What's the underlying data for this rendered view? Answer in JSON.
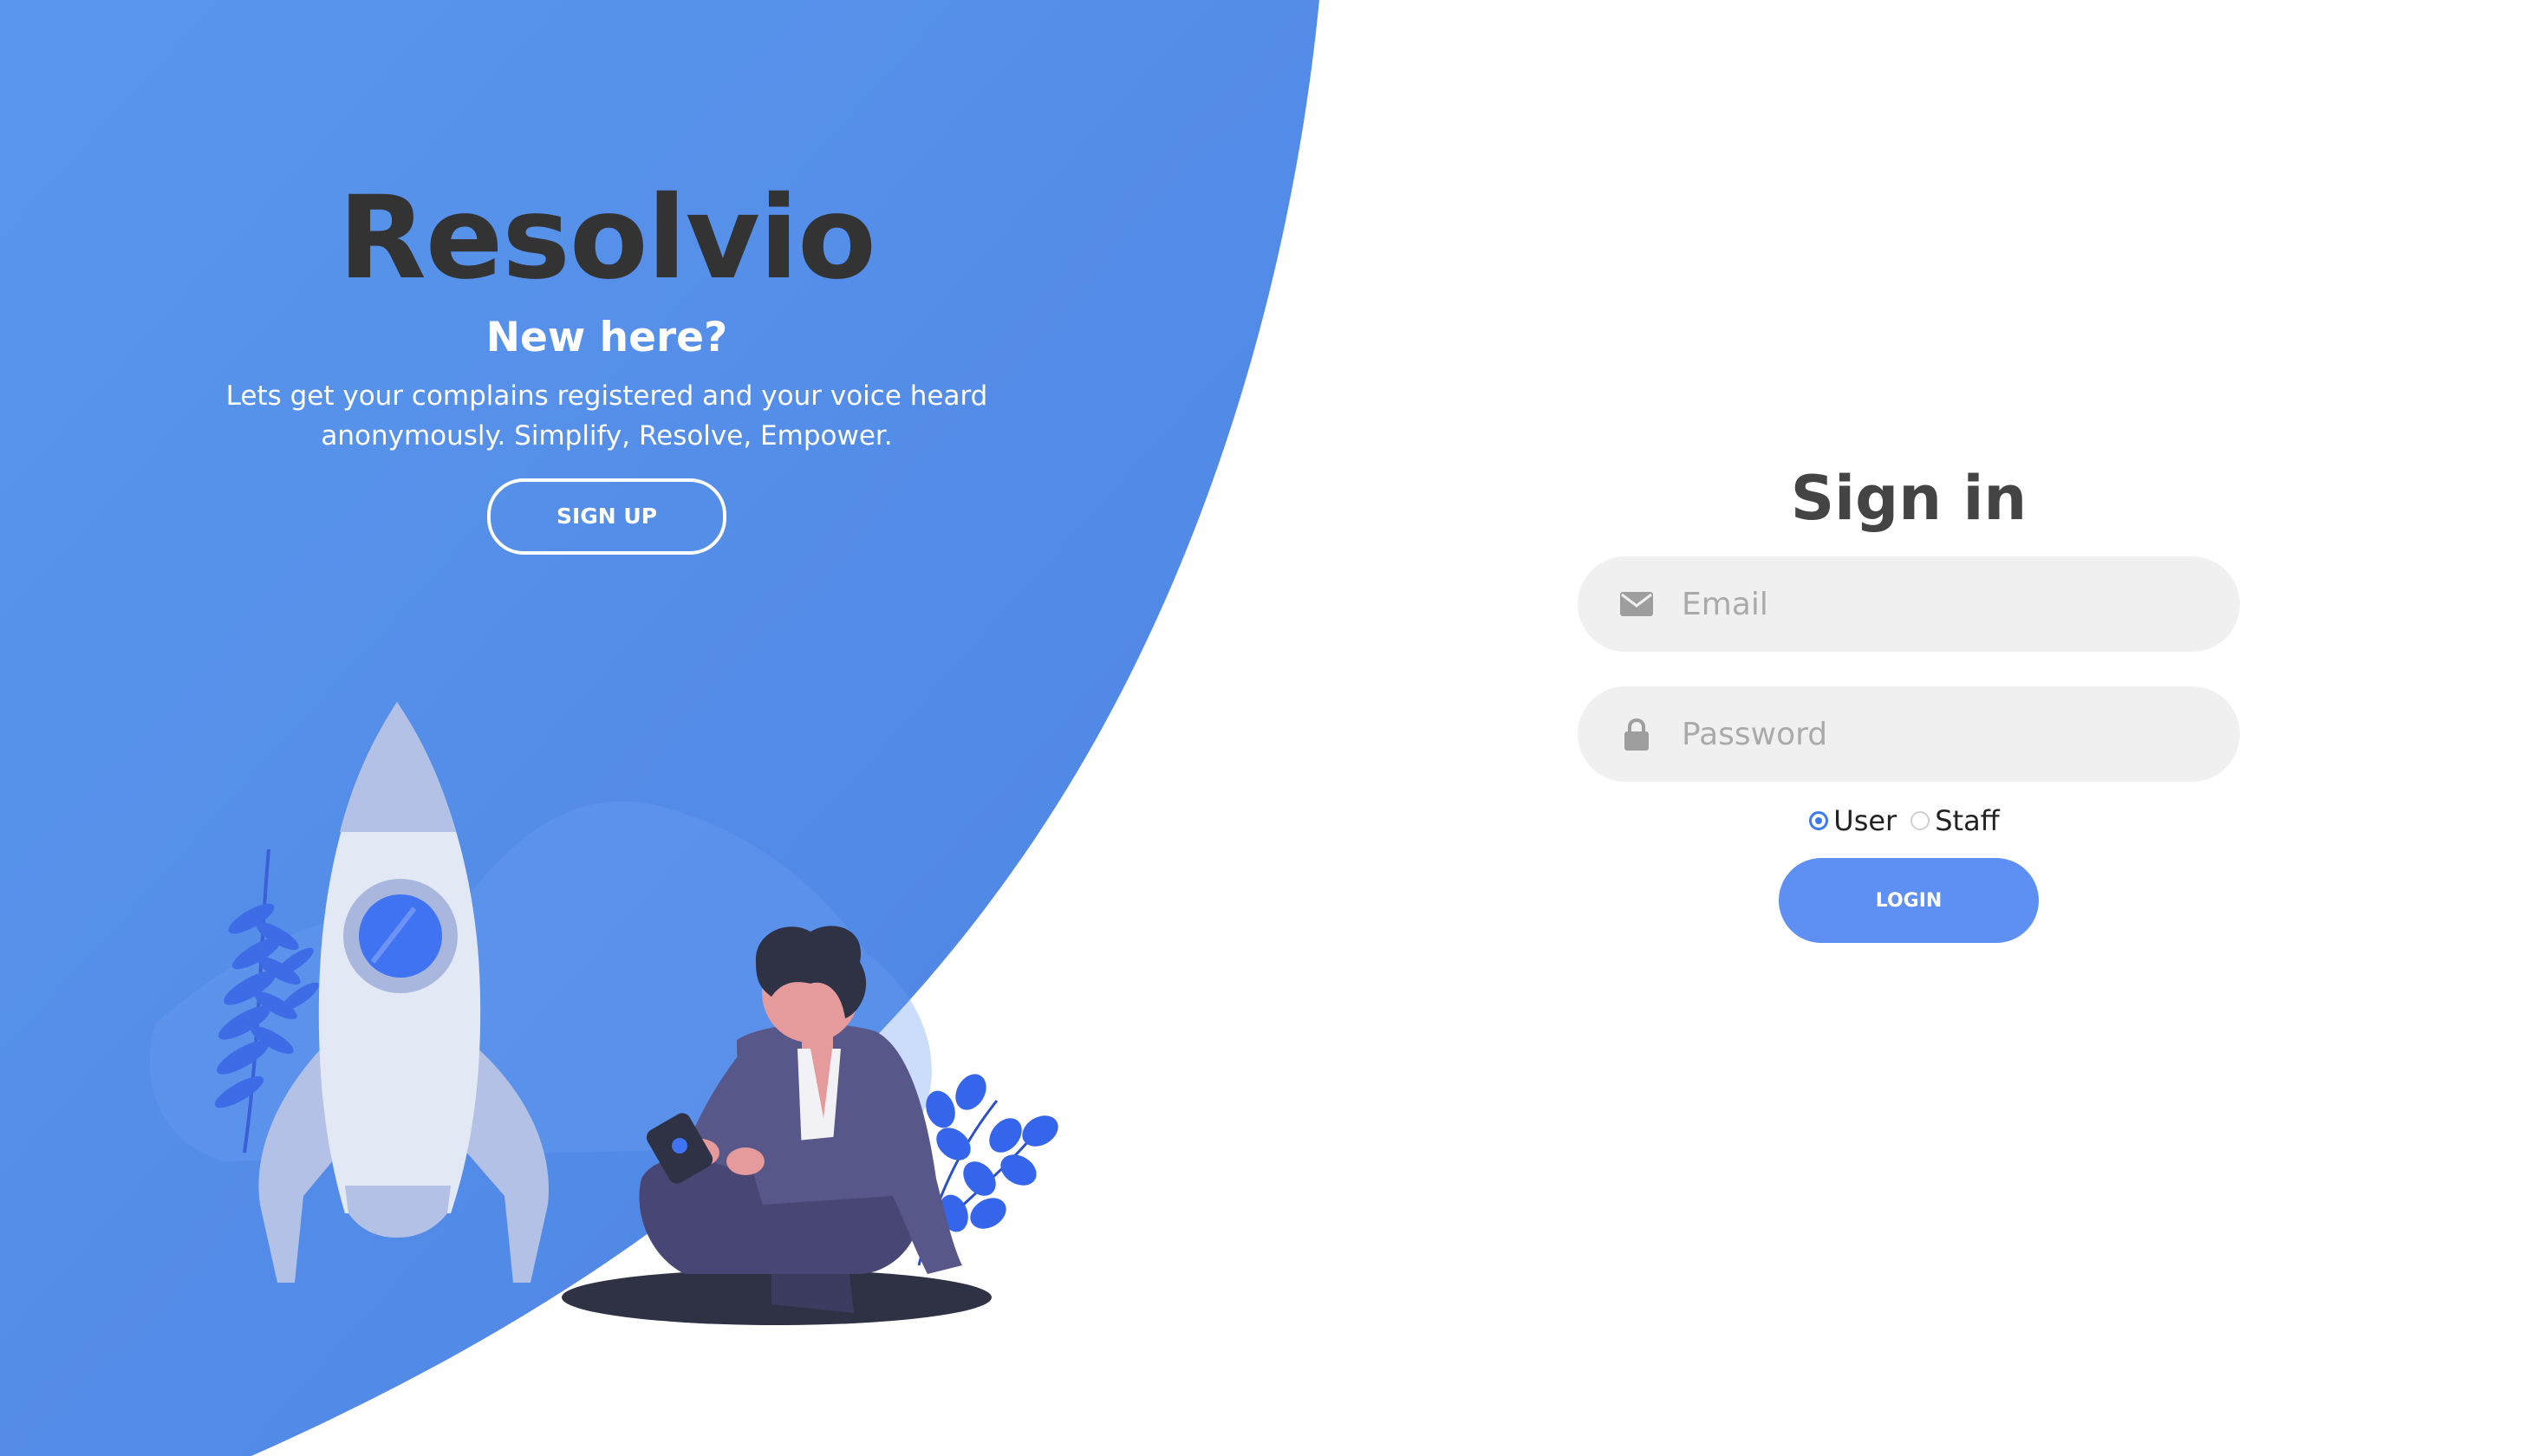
{
  "colors": {
    "panel_blue": "#5a94ec",
    "brand_dark": "#333333",
    "input_bg": "#f0f0f0",
    "login_button": "#5e8ff2",
    "accent": "#3d7bef"
  },
  "intro": {
    "brand": "Resolvio",
    "subtitle": "New here?",
    "tagline": "Lets get your complains registered and your voice heard anonymously. Simplify, Resolve, Empower.",
    "signup_label": "SIGN UP"
  },
  "login_form": {
    "title": "Sign in",
    "email_placeholder": "Email",
    "email_value": "",
    "email_icon": "envelope-icon",
    "password_placeholder": "Password",
    "password_value": "",
    "password_icon": "lock-icon",
    "roles": [
      {
        "label": "User",
        "checked": true
      },
      {
        "label": "Staff",
        "checked": false
      }
    ],
    "login_label": "LOGIN"
  },
  "illustrations": [
    "rocket-illustration",
    "person-with-phone-illustration",
    "plant-illustration"
  ]
}
